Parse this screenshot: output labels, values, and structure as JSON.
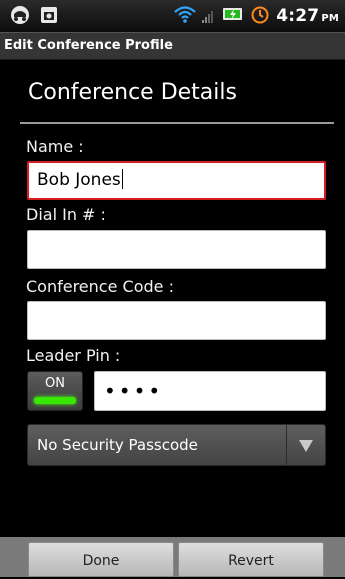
{
  "status_bar": {
    "time": "4:27",
    "ampm": "PM",
    "icons": [
      "car-icon",
      "photo-notification-icon",
      "wifi-icon",
      "signal-icon",
      "battery-charging-icon",
      "alarm-icon"
    ]
  },
  "title_bar": {
    "title": "Edit Conference Profile"
  },
  "section": {
    "header": "Conference Details"
  },
  "form": {
    "name_label": "Name :",
    "name_value": "Bob Jones",
    "dial_in_label": "Dial In # :",
    "dial_in_value": "",
    "conference_code_label": "Conference Code :",
    "conference_code_value": "",
    "leader_pin_label": "Leader Pin :",
    "leader_pin_toggle": "ON",
    "leader_pin_value": "••••",
    "security_spinner_value": "No Security Passcode"
  },
  "buttons": {
    "done": "Done",
    "revert": "Revert"
  },
  "colors": {
    "focus_border": "#d71d1d",
    "toggle_light": "#37e800",
    "title_bar": "#353535"
  }
}
